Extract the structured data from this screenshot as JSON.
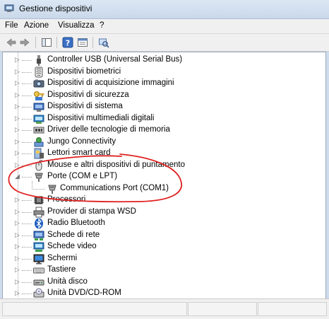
{
  "window": {
    "title": "Gestione dispositivi"
  },
  "menubar": {
    "items": [
      "File",
      "Azione",
      "Visualizza",
      "?"
    ]
  },
  "tree": {
    "items": [
      {
        "label": "Controller USB (Universal Serial Bus)",
        "icon": "usb-icon",
        "expanded": false
      },
      {
        "label": "Dispositivi biometrici",
        "icon": "biometric-icon",
        "expanded": false
      },
      {
        "label": "Dispositivi di acquisizione immagini",
        "icon": "imaging-icon",
        "expanded": false
      },
      {
        "label": "Dispositivi di sicurezza",
        "icon": "security-key-icon",
        "expanded": false
      },
      {
        "label": "Dispositivi di sistema",
        "icon": "system-device-icon",
        "expanded": false
      },
      {
        "label": "Dispositivi multimediali digitali",
        "icon": "multimedia-icon",
        "expanded": false
      },
      {
        "label": "Driver delle tecnologie di memoria",
        "icon": "memory-icon",
        "expanded": false
      },
      {
        "label": "Jungo Connectivity",
        "icon": "jungo-icon",
        "expanded": false
      },
      {
        "label": "Lettori smart card",
        "icon": "smartcard-icon",
        "expanded": false
      },
      {
        "label": "Mouse e altri dispositivi di puntamento",
        "icon": "mouse-icon",
        "expanded": false
      },
      {
        "label": "Porte (COM e LPT)",
        "icon": "port-icon",
        "expanded": true
      },
      {
        "label": "Communications Port (COM1)",
        "icon": "port-icon",
        "child": true
      },
      {
        "label": "Processori",
        "icon": "processor-icon",
        "expanded": false
      },
      {
        "label": "Provider di stampa WSD",
        "icon": "printer-icon",
        "expanded": false
      },
      {
        "label": "Radio Bluetooth",
        "icon": "bluetooth-icon",
        "expanded": false
      },
      {
        "label": "Schede di rete",
        "icon": "network-card-icon",
        "expanded": false
      },
      {
        "label": "Schede video",
        "icon": "video-card-icon",
        "expanded": false
      },
      {
        "label": "Schermi",
        "icon": "monitor-icon",
        "expanded": false
      },
      {
        "label": "Tastiere",
        "icon": "keyboard-icon",
        "expanded": false
      },
      {
        "label": "Unità disco",
        "icon": "disk-drive-icon",
        "expanded": false
      },
      {
        "label": "Unità DVD/CD-ROM",
        "icon": "dvd-drive-icon",
        "expanded": false
      }
    ]
  },
  "colors": {
    "annotation": "#e02020",
    "titlebar": "#c9d8ea",
    "tree_background": "#ffffff"
  }
}
